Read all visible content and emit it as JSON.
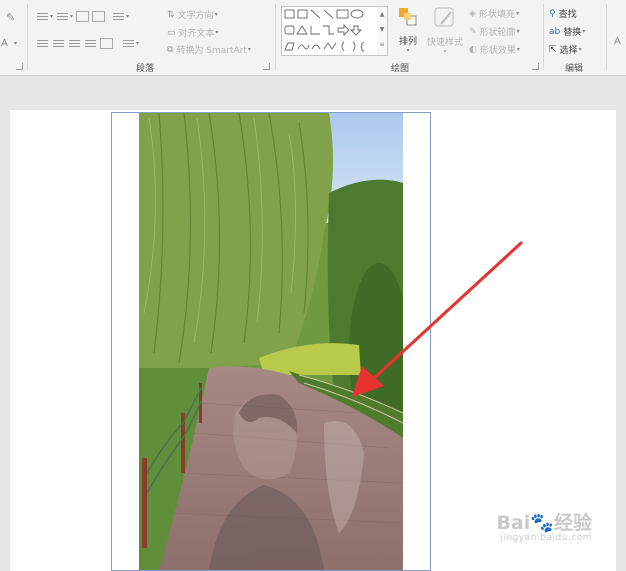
{
  "ribbon": {
    "paragraph": {
      "group_label": "段落",
      "text_direction_label": "文字方向",
      "align_text_label": "对齐文本",
      "convert_smartart_label": "转换为 SmartArt"
    },
    "drawing": {
      "group_label": "绘图",
      "arrange_label": "排列",
      "quick_styles_label": "快速样式",
      "shape_fill_label": "形状填充",
      "shape_outline_label": "形状轮廓",
      "shape_effects_label": "形状效果"
    },
    "editing": {
      "group_label": "编辑",
      "find_label": "查找",
      "replace_label": "替换",
      "select_label": "选择"
    },
    "left_stub": {
      "font_a_label": "A"
    }
  },
  "watermark": {
    "brand": "Bai",
    "brand_suffix": "经验",
    "url": "jingyan.baidu.com"
  },
  "colors": {
    "accent_arrow": "#e8322f",
    "slide_frame": "#7f9fc9",
    "ribbon_bg": "#f3f3f3",
    "workspace_bg": "#e6e6e6"
  }
}
